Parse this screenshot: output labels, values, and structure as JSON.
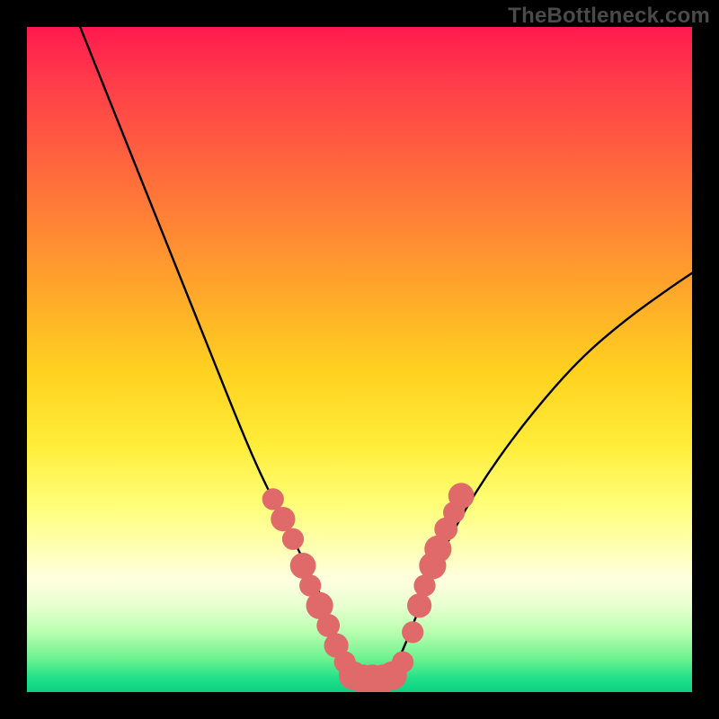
{
  "watermark": "TheBottleneck.com",
  "chart_data": {
    "type": "line",
    "title": "",
    "xlabel": "",
    "ylabel": "",
    "xlim": [
      0,
      100
    ],
    "ylim": [
      0,
      100
    ],
    "grid": false,
    "legend": false,
    "series": [
      {
        "name": "bottleneck-curve",
        "x": [
          8,
          12,
          16,
          20,
          24,
          28,
          32,
          35,
          38,
          41,
          44,
          46,
          48,
          50,
          52,
          54,
          56,
          58,
          61,
          65,
          70,
          76,
          83,
          90,
          97,
          100
        ],
        "y": [
          100,
          90,
          80,
          70,
          60,
          50,
          40,
          33,
          27,
          21,
          15,
          10,
          5,
          2,
          2,
          2,
          5,
          10,
          18,
          26,
          34,
          42,
          50,
          56,
          61,
          63
        ]
      }
    ],
    "markers": {
      "name": "highlighted-points",
      "color": "#e06a6a",
      "points": [
        {
          "x": 37,
          "y": 29,
          "r": 1.1
        },
        {
          "x": 38.5,
          "y": 26,
          "r": 1.3
        },
        {
          "x": 40,
          "y": 23,
          "r": 1.1
        },
        {
          "x": 41.5,
          "y": 19,
          "r": 1.4
        },
        {
          "x": 42.6,
          "y": 16,
          "r": 1.1
        },
        {
          "x": 44,
          "y": 13,
          "r": 1.5
        },
        {
          "x": 45.3,
          "y": 10,
          "r": 1.2
        },
        {
          "x": 46.5,
          "y": 7,
          "r": 1.3
        },
        {
          "x": 47.8,
          "y": 4.5,
          "r": 1.1
        },
        {
          "x": 49,
          "y": 2.5,
          "r": 1.6
        },
        {
          "x": 50.5,
          "y": 2,
          "r": 1.6
        },
        {
          "x": 52,
          "y": 2,
          "r": 1.6
        },
        {
          "x": 53.5,
          "y": 2,
          "r": 1.6
        },
        {
          "x": 55,
          "y": 2.5,
          "r": 1.6
        },
        {
          "x": 56.5,
          "y": 4.5,
          "r": 1.1
        },
        {
          "x": 58,
          "y": 9,
          "r": 1.1
        },
        {
          "x": 59,
          "y": 13,
          "r": 1.3
        },
        {
          "x": 59.8,
          "y": 16,
          "r": 1.1
        },
        {
          "x": 61,
          "y": 19,
          "r": 1.5
        },
        {
          "x": 61.8,
          "y": 21.5,
          "r": 1.5
        },
        {
          "x": 63,
          "y": 24.5,
          "r": 1.2
        },
        {
          "x": 64.2,
          "y": 27,
          "r": 1.1
        },
        {
          "x": 65.3,
          "y": 29.5,
          "r": 1.4
        }
      ]
    },
    "background_gradient": {
      "top": "#ff1a4d",
      "bottom": "#0ed080"
    }
  }
}
